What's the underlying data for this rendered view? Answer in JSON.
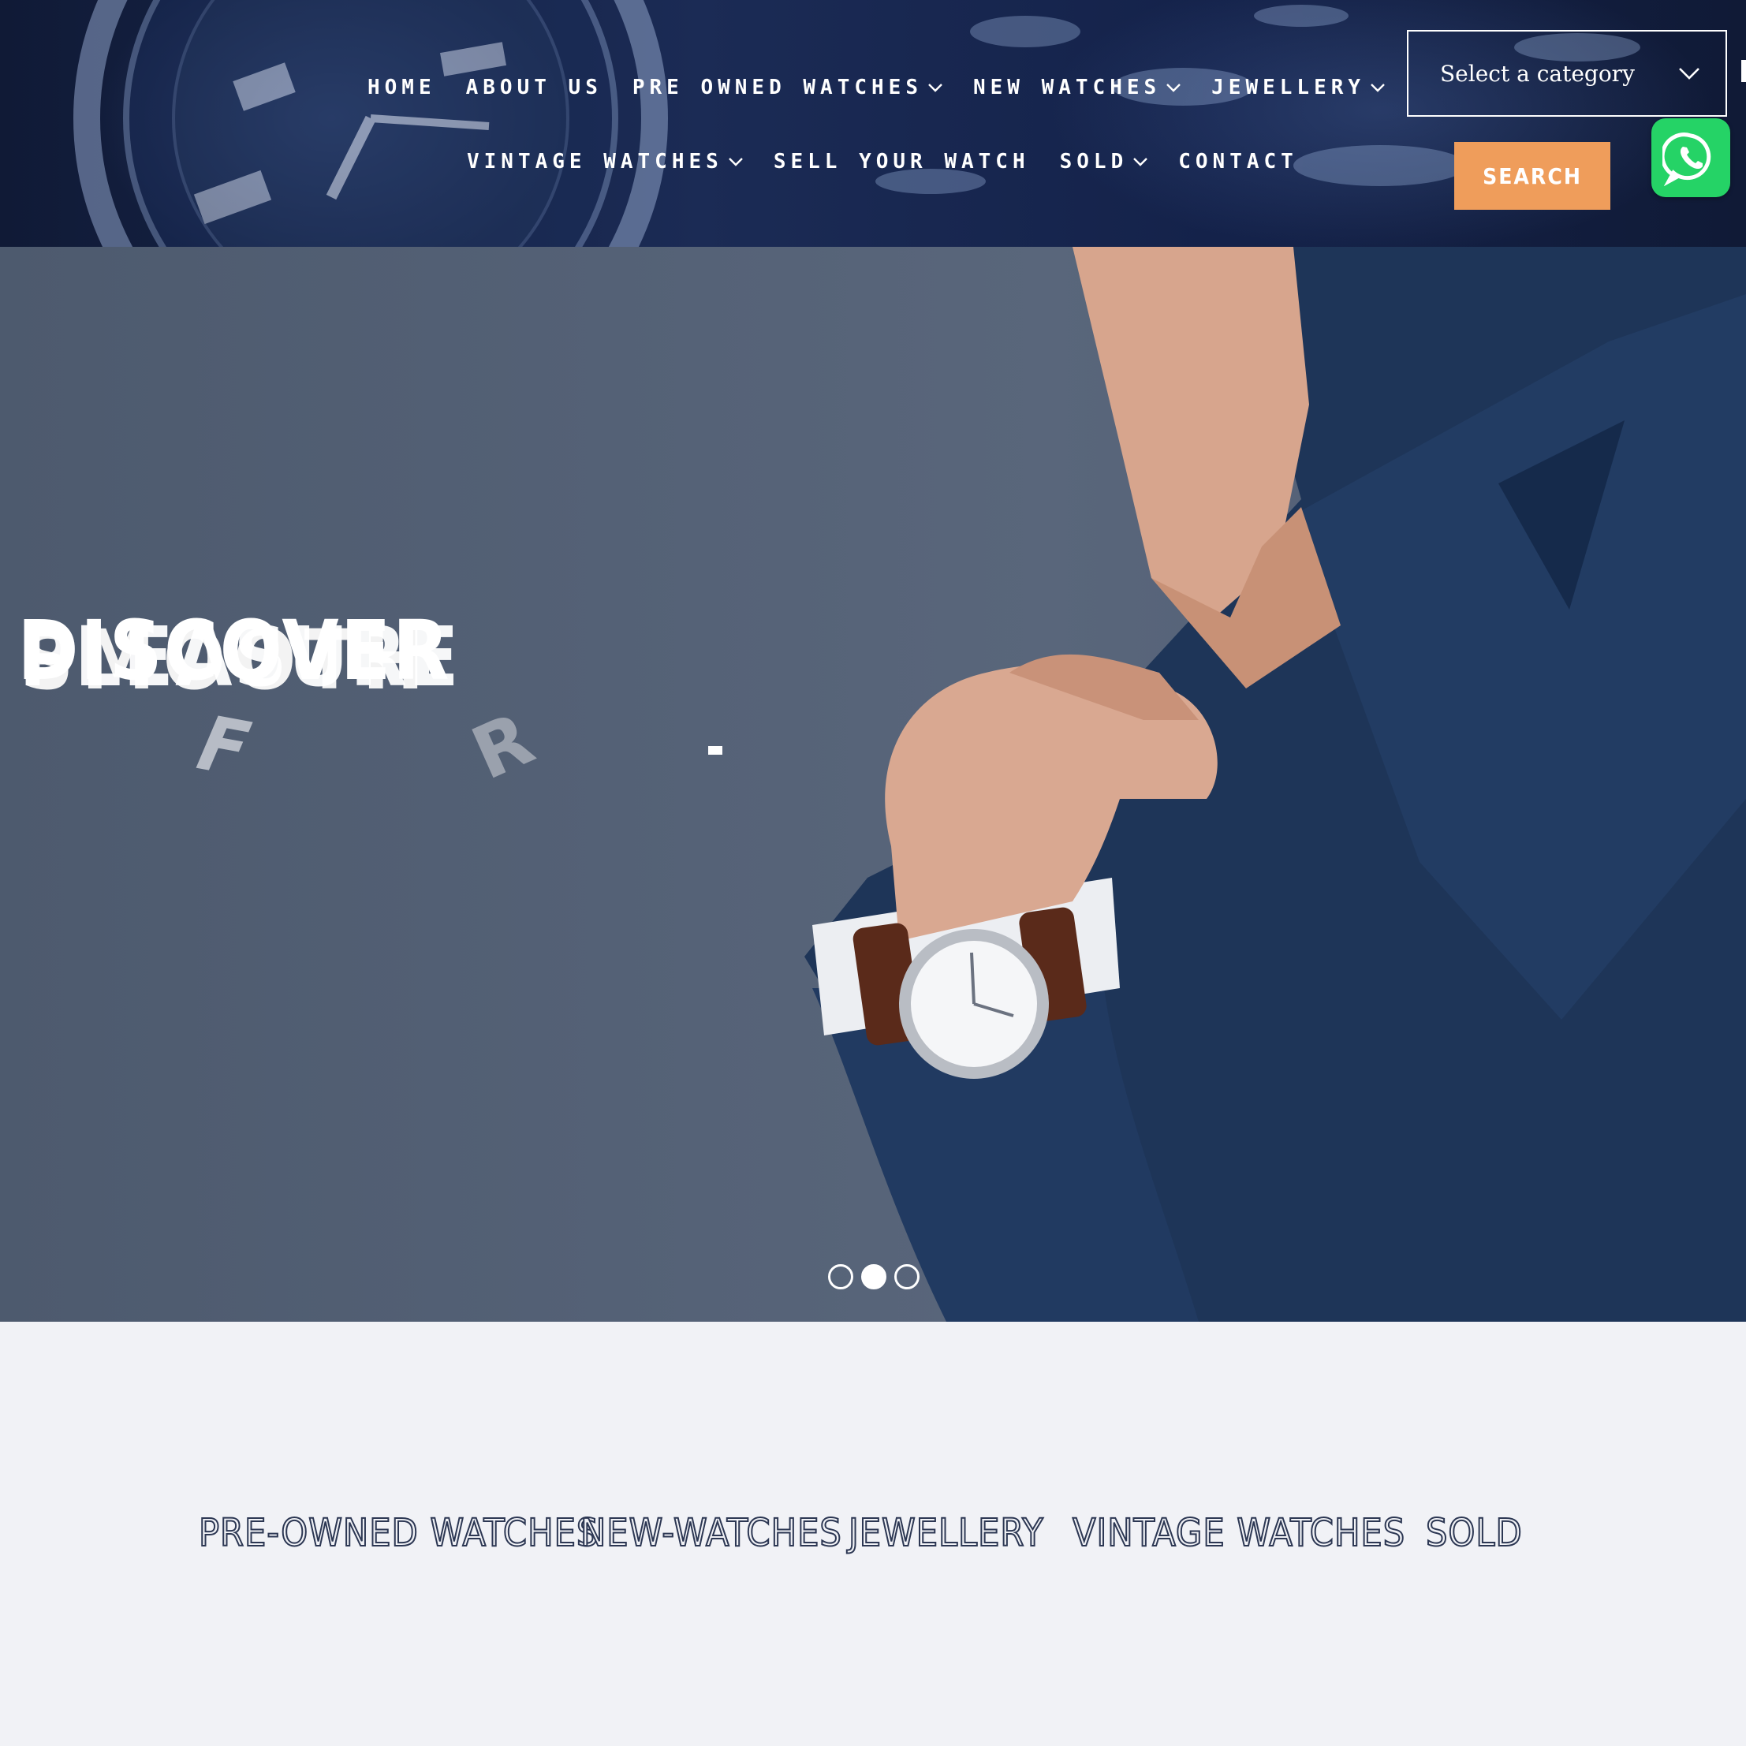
{
  "nav": {
    "row1": [
      {
        "label": "HOME",
        "has_dropdown": false
      },
      {
        "label": "ABOUT US",
        "has_dropdown": false
      },
      {
        "label": "PRE OWNED WATCHES",
        "has_dropdown": true
      },
      {
        "label": "NEW WATCHES",
        "has_dropdown": true
      },
      {
        "label": "JEWELLERY",
        "has_dropdown": true
      }
    ],
    "row2": [
      {
        "label": "VINTAGE WATCHES",
        "has_dropdown": true
      },
      {
        "label": "SELL YOUR WATCH",
        "has_dropdown": false
      },
      {
        "label": "SOLD",
        "has_dropdown": true
      },
      {
        "label": "CONTACT",
        "has_dropdown": false
      }
    ]
  },
  "search": {
    "category_placeholder": "Select a category",
    "button_label": "SEARCH"
  },
  "whatsapp": {
    "icon": "whatsapp-icon",
    "color": "#25d366"
  },
  "hero": {
    "headline_a": "DISCOVER",
    "headline_b": "SMOOTH",
    "headline_c": "PLEASURE",
    "fragment_f": "F",
    "fragment_r": "R",
    "slides_total": 3,
    "active_slide": 2
  },
  "categories": [
    {
      "label": "PRE-OWNED WATCHES"
    },
    {
      "label": "NEW-WATCHES"
    },
    {
      "label": "JEWELLERY"
    },
    {
      "label": "VINTAGE WATCHES"
    },
    {
      "label": "SOLD"
    }
  ],
  "colors": {
    "header_bg": "#14224a",
    "accent_orange": "#ef9d5b",
    "category_text": "#2c3753",
    "page_bg": "#f1f2f6"
  }
}
